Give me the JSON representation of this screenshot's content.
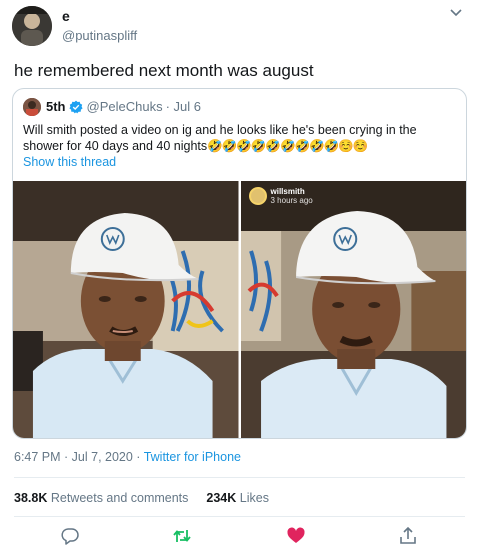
{
  "author": {
    "name": "e",
    "handle": "@putinaspliff"
  },
  "tweet_text": "he remembered next month was august",
  "quoted": {
    "name": "5th",
    "handle": "@PeleChuks",
    "date": "· Jul 6",
    "text": "Will smith posted a video on ig and he looks like he's been crying in the shower for 40 days and 40 nights",
    "emoji": "🤣🤣🤣🤣🤣🤣🤣🤣🤣☺️☺️",
    "thread_link": "Show this thread",
    "photo2_overlay": {
      "user": "willsmith",
      "time": "3 hours ago"
    }
  },
  "timestamp": "6:47 PM · Jul 7, 2020 · ",
  "source": "Twitter for iPhone",
  "stats": {
    "retweets_value": "38.8K",
    "retweets_label": "Retweets and comments",
    "likes_value": "234K",
    "likes_label": "Likes"
  },
  "colors": {
    "link": "#1b95e0",
    "retweet": "#17bf63",
    "like": "#e0245e",
    "muted": "#657786"
  },
  "icons": [
    "chevron-down-icon",
    "verified-badge-icon",
    "reply-icon",
    "retweet-icon",
    "like-icon",
    "share-icon"
  ]
}
